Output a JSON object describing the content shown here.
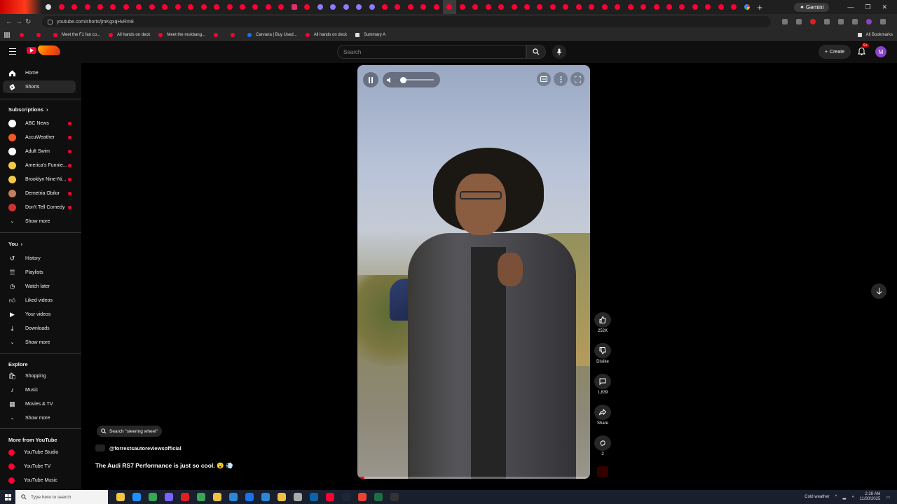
{
  "browser": {
    "url": "youtube.com/shorts/jmKgxqHvRm8",
    "gemini_label": "Gemini",
    "bookmarks": [
      "Meet the F1 fan co...",
      "All hands on deck",
      "Meet the mukbang...",
      "Carvana | Buy Used...",
      "All hands on deck",
      "Summary A"
    ],
    "all_bookmarks_label": "All Bookmarks"
  },
  "masthead": {
    "search_placeholder": "Search",
    "create_label": "Create",
    "notif_badge": "9+",
    "avatar_initial": "M"
  },
  "guide": {
    "main": [
      {
        "label": "Home",
        "icon": "home-icon"
      },
      {
        "label": "Shorts",
        "icon": "shorts-icon"
      }
    ],
    "subscriptions_title": "Subscriptions",
    "subscriptions": [
      {
        "label": "ABC News",
        "color": "#ffffff"
      },
      {
        "label": "AccuWeather",
        "color": "#f05a28"
      },
      {
        "label": "Adult Swim",
        "color": "#ffffff"
      },
      {
        "label": "America's Funnie...",
        "color": "#f2c94c"
      },
      {
        "label": "Brooklyn Nine-Ni...",
        "color": "#f2c94c"
      },
      {
        "label": "Demetria Obilor",
        "color": "#c08060"
      },
      {
        "label": "Don't Tell Comedy",
        "color": "#cc3333"
      }
    ],
    "show_more": "Show more",
    "you_title": "You",
    "you_items": [
      {
        "label": "History",
        "icon": "history-icon"
      },
      {
        "label": "Playlists",
        "icon": "playlists-icon"
      },
      {
        "label": "Watch later",
        "icon": "watch-later-icon"
      },
      {
        "label": "Liked videos",
        "icon": "like-icon"
      },
      {
        "label": "Your videos",
        "icon": "your-videos-icon"
      },
      {
        "label": "Downloads",
        "icon": "download-icon"
      }
    ],
    "explore_title": "Explore",
    "explore_items": [
      {
        "label": "Shopping",
        "icon": "shopping-icon"
      },
      {
        "label": "Music",
        "icon": "music-icon"
      },
      {
        "label": "Movies & TV",
        "icon": "movies-icon"
      }
    ],
    "more_title": "More from YouTube",
    "more_items": [
      {
        "label": "YouTube Studio"
      },
      {
        "label": "YouTube TV"
      },
      {
        "label": "YouTube Music"
      }
    ]
  },
  "short": {
    "suggest": "Search \"steering wheel\"",
    "channel": "@forrestsautoreviewsofficial",
    "title": "The Audi RS7 Performance is just so cool. 😮 💨",
    "progress": 0.03
  },
  "actions": {
    "likes": "252K",
    "dislike": "Dislike",
    "comments": "1,839",
    "share": "Share",
    "remix": "2"
  },
  "taskbar": {
    "search_placeholder": "Type here to search",
    "weather": "Cold weather",
    "time": "2:28 AM",
    "date": "11/30/2025"
  },
  "colors": {
    "accent": "#ff0033",
    "background": "#0f0f0f"
  }
}
